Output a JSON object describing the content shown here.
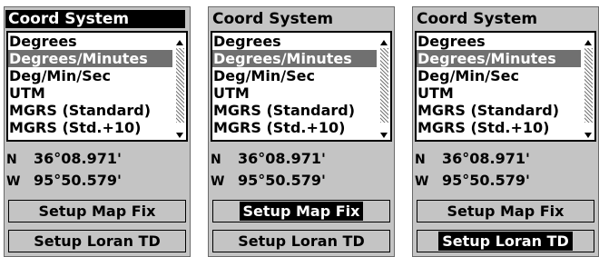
{
  "panels": [
    {
      "title": "Coord System",
      "title_highlighted": true,
      "list": [
        "Degrees",
        "Degrees/Minutes",
        "Deg/Min/Sec",
        "UTM",
        "MGRS (Standard)",
        "MGRS (Std.+10)"
      ],
      "selected_index": 1,
      "latitude_dir": "N",
      "latitude": "36°08.971'",
      "longitude_dir": "W",
      "longitude": "95°50.579'",
      "buttons": [
        "Setup Map Fix",
        "Setup Loran TD"
      ],
      "focused_button": -1
    },
    {
      "title": "Coord System",
      "title_highlighted": false,
      "list": [
        "Degrees",
        "Degrees/Minutes",
        "Deg/Min/Sec",
        "UTM",
        "MGRS (Standard)",
        "MGRS (Std.+10)"
      ],
      "selected_index": 1,
      "latitude_dir": "N",
      "latitude": "36°08.971'",
      "longitude_dir": "W",
      "longitude": "95°50.579'",
      "buttons": [
        "Setup Map Fix",
        "Setup Loran TD"
      ],
      "focused_button": 0
    },
    {
      "title": "Coord System",
      "title_highlighted": false,
      "list": [
        "Degrees",
        "Degrees/Minutes",
        "Deg/Min/Sec",
        "UTM",
        "MGRS (Standard)",
        "MGRS (Std.+10)"
      ],
      "selected_index": 1,
      "latitude_dir": "N",
      "latitude": "36°08.971'",
      "longitude_dir": "W",
      "longitude": "95°50.579'",
      "buttons": [
        "Setup Map Fix",
        "Setup Loran TD"
      ],
      "focused_button": 1
    }
  ],
  "colors": {
    "screen_bg": "#c4c4c4",
    "selection": "#707070",
    "highlight": "#000000"
  },
  "icons": {
    "scroll_up": "triangle-up-icon",
    "scroll_down": "triangle-down-icon"
  }
}
